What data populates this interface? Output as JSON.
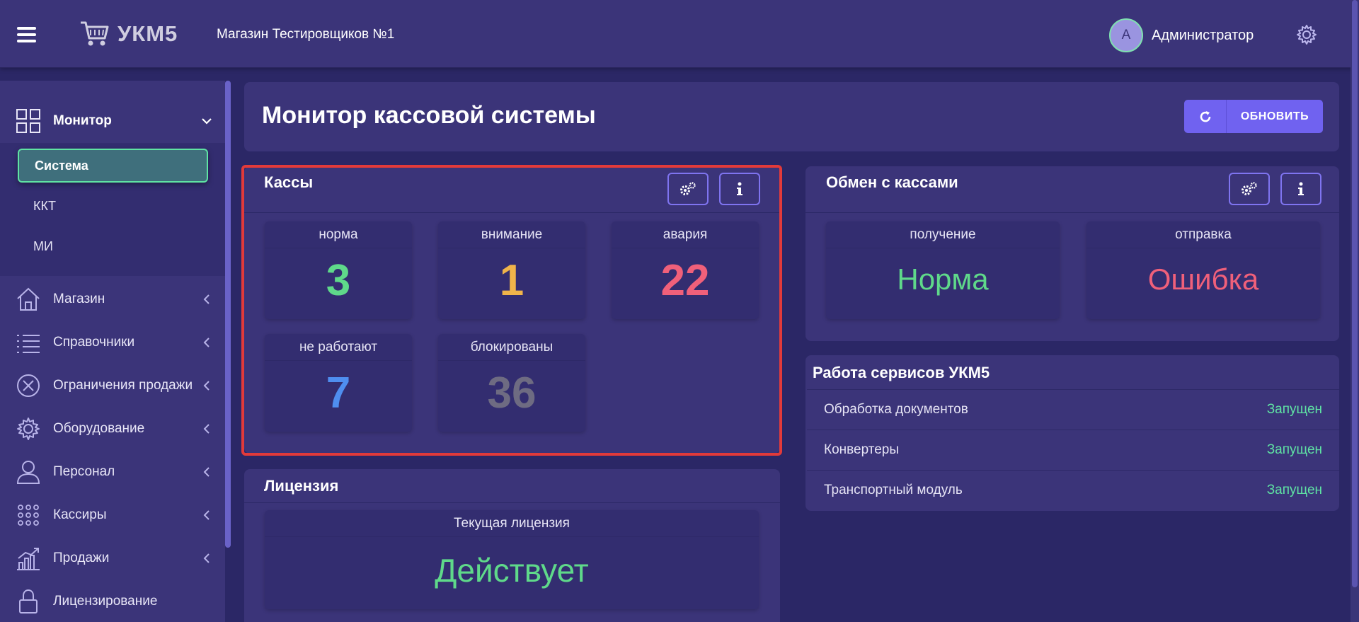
{
  "header": {
    "logo_text": "УКМ5",
    "store_name": "Магазин Тестировщиков №1",
    "avatar_letter": "A",
    "user_name": "Администратор"
  },
  "sidebar": {
    "monitor": {
      "label": "Монитор",
      "icon": "dashboard-grid-icon"
    },
    "submenu": [
      "Система",
      "ККТ",
      "МИ"
    ],
    "items": [
      {
        "label": "Магазин",
        "icon": "house-icon"
      },
      {
        "label": "Справочники",
        "icon": "list-icon"
      },
      {
        "label": "Ограничения продажи",
        "icon": "circle-x-icon"
      },
      {
        "label": "Оборудование",
        "icon": "gear-icon"
      },
      {
        "label": "Персонал",
        "icon": "person-icon"
      },
      {
        "label": "Кассиры",
        "icon": "dots-grid-icon"
      },
      {
        "label": "Продажи",
        "icon": "chart-icon"
      },
      {
        "label": "Лицензирование",
        "icon": "lock-icon"
      }
    ]
  },
  "main": {
    "title": "Монитор кассовой системы",
    "refresh_label": "ОБНОВИТЬ",
    "kassy": {
      "title": "Кассы",
      "stats": [
        {
          "label": "норма",
          "value": "3",
          "color": "#5fd98a"
        },
        {
          "label": "внимание",
          "value": "1",
          "color": "#f0b44a"
        },
        {
          "label": "авария",
          "value": "22",
          "color": "#f0607a"
        },
        {
          "label": "не работают",
          "value": "7",
          "color": "#4f8ef0"
        },
        {
          "label": "блокированы",
          "value": "36",
          "color": "#6e6b82"
        }
      ]
    },
    "exchange": {
      "title": "Обмен с кассами",
      "receive_label": "получение",
      "receive_value": "Норма",
      "send_label": "отправка",
      "send_value": "Ошибка"
    },
    "services": {
      "title": "Работа сервисов УКМ5",
      "rows": [
        {
          "name": "Обработка документов",
          "status": "Запущен"
        },
        {
          "name": "Конвертеры",
          "status": "Запущен"
        },
        {
          "name": "Транспортный модуль",
          "status": "Запущен"
        }
      ]
    },
    "license": {
      "title": "Лицензия",
      "current_label": "Текущая лицензия",
      "current_value": "Действует"
    }
  },
  "colors": {
    "bg": "#2b2766",
    "panel": "#3b3479",
    "accent": "#7062f0",
    "ok": "#5fd98a",
    "error": "#f0607a"
  }
}
